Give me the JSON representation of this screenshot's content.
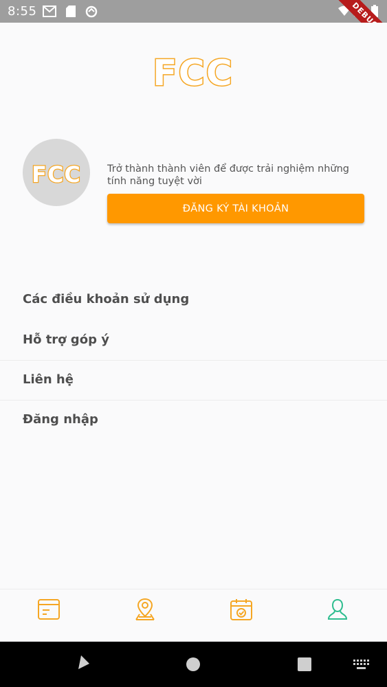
{
  "status_bar": {
    "time": "8:55",
    "debug_label": "DEBUG",
    "icons": [
      "gmail-icon",
      "sd-card-icon",
      "sync-icon",
      "wifi-icon",
      "signal-icon",
      "battery-icon"
    ]
  },
  "logo": {
    "text": "FCC"
  },
  "profile": {
    "avatar_text": "FCC",
    "promo_text": "Trở thành thành viên để được trải nghiệm những tính năng tuyệt vời",
    "register_label": "ĐĂNG KÝ TÀI KHOẢN"
  },
  "menu": {
    "items": [
      {
        "label": "Các điều khoản sử dụng"
      },
      {
        "label": "Hỗ trợ góp ý"
      },
      {
        "label": "Liên hệ"
      },
      {
        "label": "Đăng nhập"
      }
    ]
  },
  "bottom_nav": {
    "items": [
      {
        "icon": "news-icon",
        "active": false
      },
      {
        "icon": "map-pin-icon",
        "active": false
      },
      {
        "icon": "calendar-check-icon",
        "active": false
      },
      {
        "icon": "user-icon",
        "active": true
      }
    ],
    "color": "#f5a623",
    "active_color": "#2ebd8f"
  },
  "colors": {
    "accent": "#ff9800",
    "logo_fill": "#ffffff",
    "logo_stroke": "#f5a623"
  }
}
